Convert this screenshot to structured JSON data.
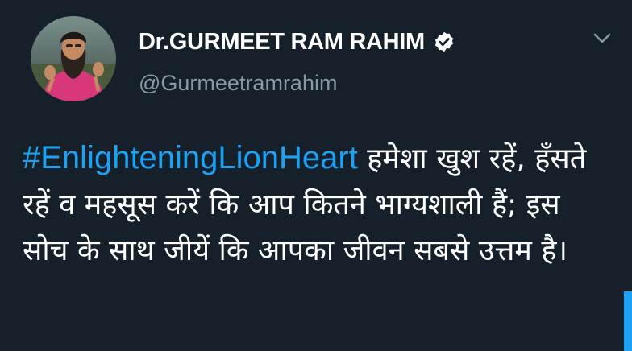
{
  "tweet": {
    "author": {
      "display_name": "Dr.GURMEET RAM RAHIM",
      "handle": "@Gurmeetramrahim",
      "verified": true
    },
    "hashtag": "#EnlighteningLionHeart",
    "body_text": " हमेशा खुश रहें, हँसते रहें व महसूस करें कि आप कितने भाग्यशाली हैं; इस सोच के साथ जीयें कि आपका जीवन सबसे उत्तम है।",
    "icons": {
      "verified": "verified-badge-icon",
      "menu": "chevron-down-icon"
    }
  },
  "colors": {
    "background": "#15202b",
    "text_primary": "#ffffff",
    "text_secondary": "#8899a6",
    "accent": "#1da1f2"
  }
}
